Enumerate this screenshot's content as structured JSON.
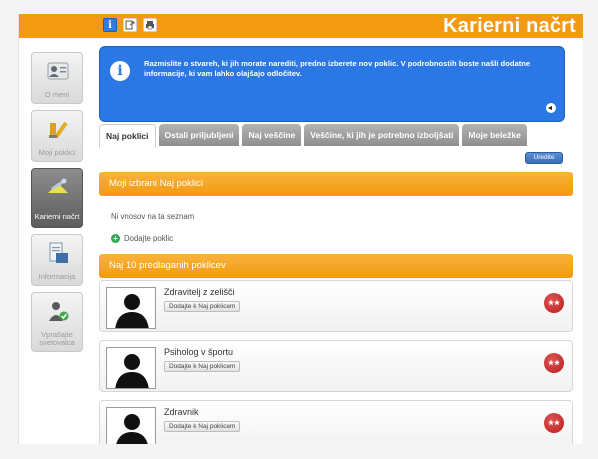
{
  "toolbar": {
    "title": "Karierni načrt",
    "tools": [
      "info-icon",
      "export-icon",
      "print-icon"
    ]
  },
  "sidebar": {
    "items": [
      {
        "label": "O meni",
        "icon": "profile-icon",
        "active": false
      },
      {
        "label": "Moji poklici",
        "icon": "ladder-icon",
        "active": false
      },
      {
        "label": "Karierni načrt",
        "icon": "career-plan-icon",
        "active": true
      },
      {
        "label": "Informacija",
        "icon": "info-doc-icon",
        "active": false
      },
      {
        "label": "Vprašajte svetovalca",
        "icon": "advisor-icon",
        "active": false
      }
    ]
  },
  "info": {
    "message": "Razmislite o stvareh, ki jih morate narediti, predno izberete nov poklic. V podrobnostih boste našli dodatne informacije, ki vam lahko olajšajo odločitev."
  },
  "tabs": [
    {
      "label": "Naj poklici",
      "active": true
    },
    {
      "label": "Ostali priljubljeni",
      "active": false
    },
    {
      "label": "Naj veščine",
      "active": false
    },
    {
      "label": "Veščine, ki jih je potrebno izboljšati",
      "active": false
    },
    {
      "label": "Moje beležke",
      "active": false
    }
  ],
  "edit_button": "Uredite",
  "favorites": {
    "heading": "Moji izbrani Naj poklici",
    "empty_text": "Ni vnosov na ta seznam",
    "add_label": "Dodajte poklic"
  },
  "top10": {
    "heading": "Naj 10 predlaganih poklicev",
    "add_to_label": "Dodajte k Naj poklicem",
    "jobs": [
      {
        "name": "Zdravitelj z zelišči"
      },
      {
        "name": "Psiholog v športu"
      },
      {
        "name": "Zdravnik"
      }
    ]
  },
  "colors": {
    "orange": "#f39a12",
    "info_blue": "#2b78e4",
    "badge_red": "#c22525"
  }
}
